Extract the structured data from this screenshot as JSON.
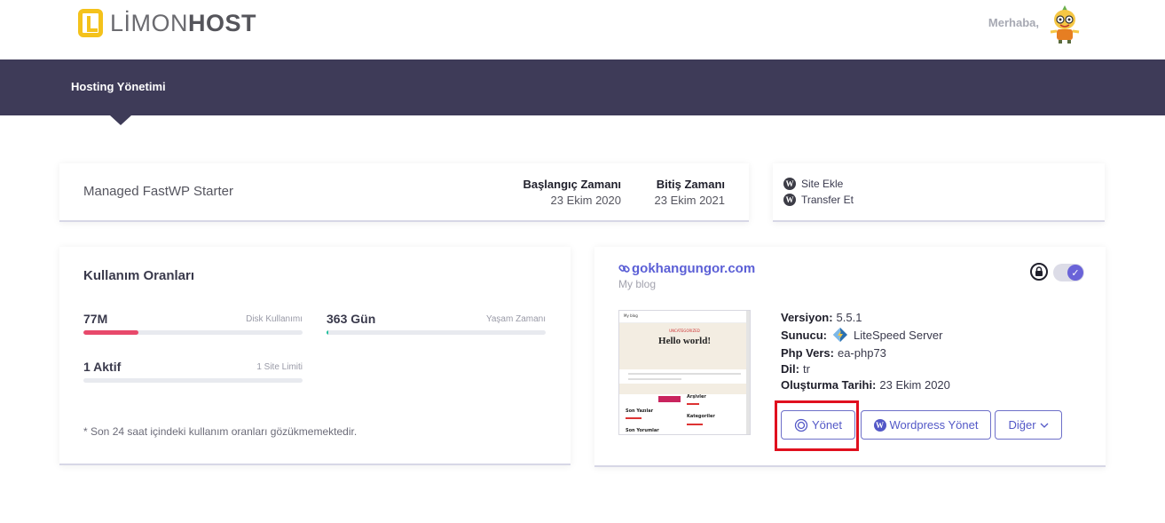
{
  "brand": {
    "logo_prefix": "LİMON",
    "logo_suffix": "HOST"
  },
  "header": {
    "greeting": "Merhaba,"
  },
  "nav": {
    "title": "Hosting Yönetimi"
  },
  "plan": {
    "name": "Managed FastWP Starter",
    "start_label": "Başlangıç Zamanı",
    "start_value": "23 Ekim 2020",
    "end_label": "Bitiş Zamanı",
    "end_value": "23 Ekim 2021"
  },
  "actions": {
    "add_site": "Site Ekle",
    "transfer": "Transfer Et"
  },
  "usage": {
    "title": "Kullanım Oranları",
    "disk": {
      "value": "77M",
      "label": "Disk Kullanımı",
      "fill": 0.25,
      "color": "#e8496b"
    },
    "life": {
      "value": "363 Gün",
      "label": "Yaşam Zamanı",
      "fill": 0.01,
      "color": "#1fbf9c"
    },
    "sites": {
      "value": "1 Aktif",
      "label": "1 Site Limiti",
      "fill": 0.0,
      "color": "#5b5fd6"
    },
    "note": "* Son 24 saat içindeki kullanım oranları gözükmemektedir."
  },
  "site": {
    "domain": "gokhangungor.com",
    "subtitle": "My blog",
    "thumb": {
      "site_name": "My blog",
      "hero_small": "UNCATEGORIZED",
      "hero_title": "Hello world!",
      "widget_1": "Son Yazılar",
      "widget_2": "Arşivler",
      "widget_3": "Kategoriler",
      "widget_4": "Son Yorumlar"
    },
    "version_label": "Versiyon:",
    "version_value": "5.5.1",
    "server_label": "Sunucu:",
    "server_value": "LiteSpeed Server",
    "php_label": "Php Vers:",
    "php_value": "ea-php73",
    "lang_label": "Dil:",
    "lang_value": "tr",
    "created_label": "Oluşturma Tarihi:",
    "created_value": "23 Ekim 2020",
    "btn_manage": "Yönet",
    "btn_wp_manage": "Wordpress Yönet",
    "btn_other": "Diğer"
  },
  "colors": {
    "accent": "#5b5fd6",
    "nav": "#3e3b58",
    "highlight": "#e0101e",
    "logo": "#f4c21b"
  }
}
